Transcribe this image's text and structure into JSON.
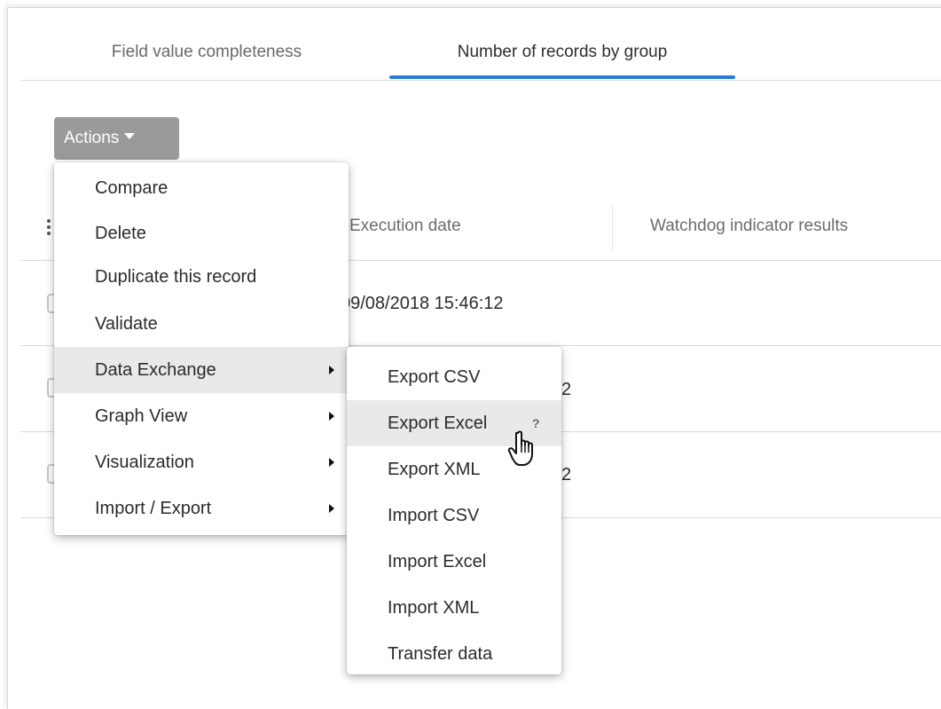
{
  "tabs": [
    {
      "label": "Field value completeness",
      "active": false
    },
    {
      "label": "Number of records by group",
      "active": true
    }
  ],
  "actions": {
    "label": "Actions"
  },
  "table": {
    "columns": [
      "Execution date",
      "Watchdog indicator results"
    ],
    "rows": [
      {
        "execution_date": "09/08/2018 15:46:12"
      },
      {
        "execution_date": "2"
      },
      {
        "execution_date": "2"
      }
    ]
  },
  "menu": {
    "items": [
      {
        "label": "Compare"
      },
      {
        "label": "Delete"
      },
      {
        "label": "Duplicate this record"
      },
      {
        "label": "Validate"
      },
      {
        "label": "Data Exchange",
        "submenu": true,
        "highlighted": true
      },
      {
        "label": "Graph View",
        "submenu": true
      },
      {
        "label": "Visualization",
        "submenu": true
      },
      {
        "label": "Import / Export",
        "submenu": true
      }
    ]
  },
  "submenu": {
    "items": [
      {
        "label": "Export CSV"
      },
      {
        "label": "Export Excel",
        "highlighted": true,
        "help": "?"
      },
      {
        "label": "Export XML"
      },
      {
        "label": "Import CSV"
      },
      {
        "label": "Import Excel"
      },
      {
        "label": "Import XML"
      },
      {
        "label": "Transfer data"
      }
    ]
  },
  "colors": {
    "accent": "#2b7cd6",
    "button": "#9a9a9a",
    "highlight": "#e9e9e9"
  },
  "icons": {
    "caret": "caret-down-icon",
    "cursor": "hand-pointer-icon"
  }
}
